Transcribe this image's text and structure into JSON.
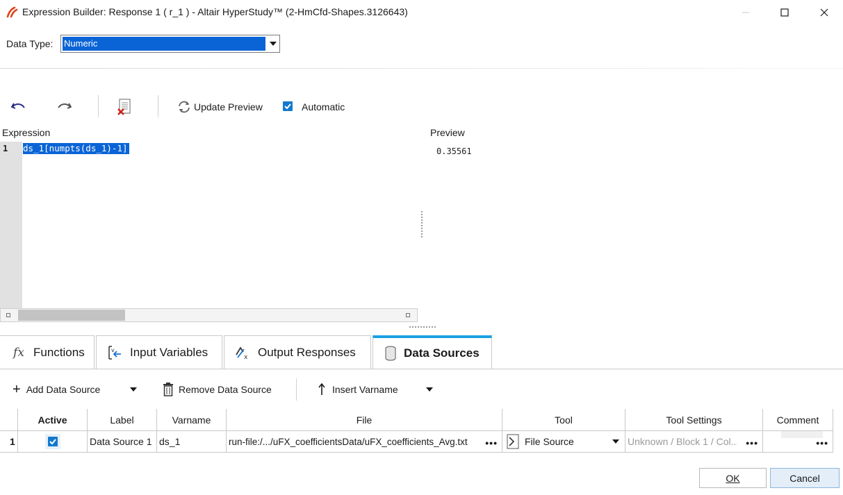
{
  "window": {
    "title": "Expression Builder: Response 1 ( r_1 ) - Altair HyperStudy™ (2-HmCfd-Shapes.3126643)",
    "logo_icon": "altair-logo-icon",
    "controls": [
      "minimize-icon",
      "maximize-icon",
      "close-icon"
    ]
  },
  "data_type": {
    "label": "Data Type:",
    "value": "Numeric"
  },
  "toolbar": {
    "undo_icon": "undo-icon",
    "redo_icon": "redo-icon",
    "clear_icon": "clear-expression-icon",
    "update_preview_label": "Update Preview",
    "automatic_label": "Automatic",
    "automatic_checked": true
  },
  "editor": {
    "expression_label": "Expression",
    "preview_label": "Preview",
    "line_number": "1",
    "expression": "ds_1[numpts(ds_1)-1]",
    "preview_value": "0.35561"
  },
  "tabs": [
    {
      "label": "Functions",
      "icon": "fx-icon",
      "active": false
    },
    {
      "label": "Input Variables",
      "icon": "input-variables-icon",
      "active": false
    },
    {
      "label": "Output Responses",
      "icon": "output-responses-icon",
      "active": false
    },
    {
      "label": "Data Sources",
      "icon": "database-icon",
      "active": true
    }
  ],
  "ds_toolbar": {
    "add_label": "Add Data Source",
    "remove_label": "Remove Data Source",
    "insert_label": "Insert Varname"
  },
  "table": {
    "columns": [
      "",
      "Active",
      "Label",
      "Varname",
      "File",
      "Tool",
      "Tool Settings",
      "Comment"
    ],
    "rows": [
      {
        "index": "1",
        "active": true,
        "label": "Data Source 1",
        "varname": "ds_1",
        "file": "run-file:/.../uFX_coefficientsData/uFX_coefficients_Avg.txt",
        "tool": "File Source",
        "tool_settings": "Unknown / Block 1 / Col...",
        "comment": ""
      }
    ]
  },
  "buttons": {
    "ok": "OK",
    "cancel": "Cancel"
  },
  "colors": {
    "accent": "#1aa1e1",
    "selection": "#0a64d6",
    "check": "#1479cc"
  }
}
